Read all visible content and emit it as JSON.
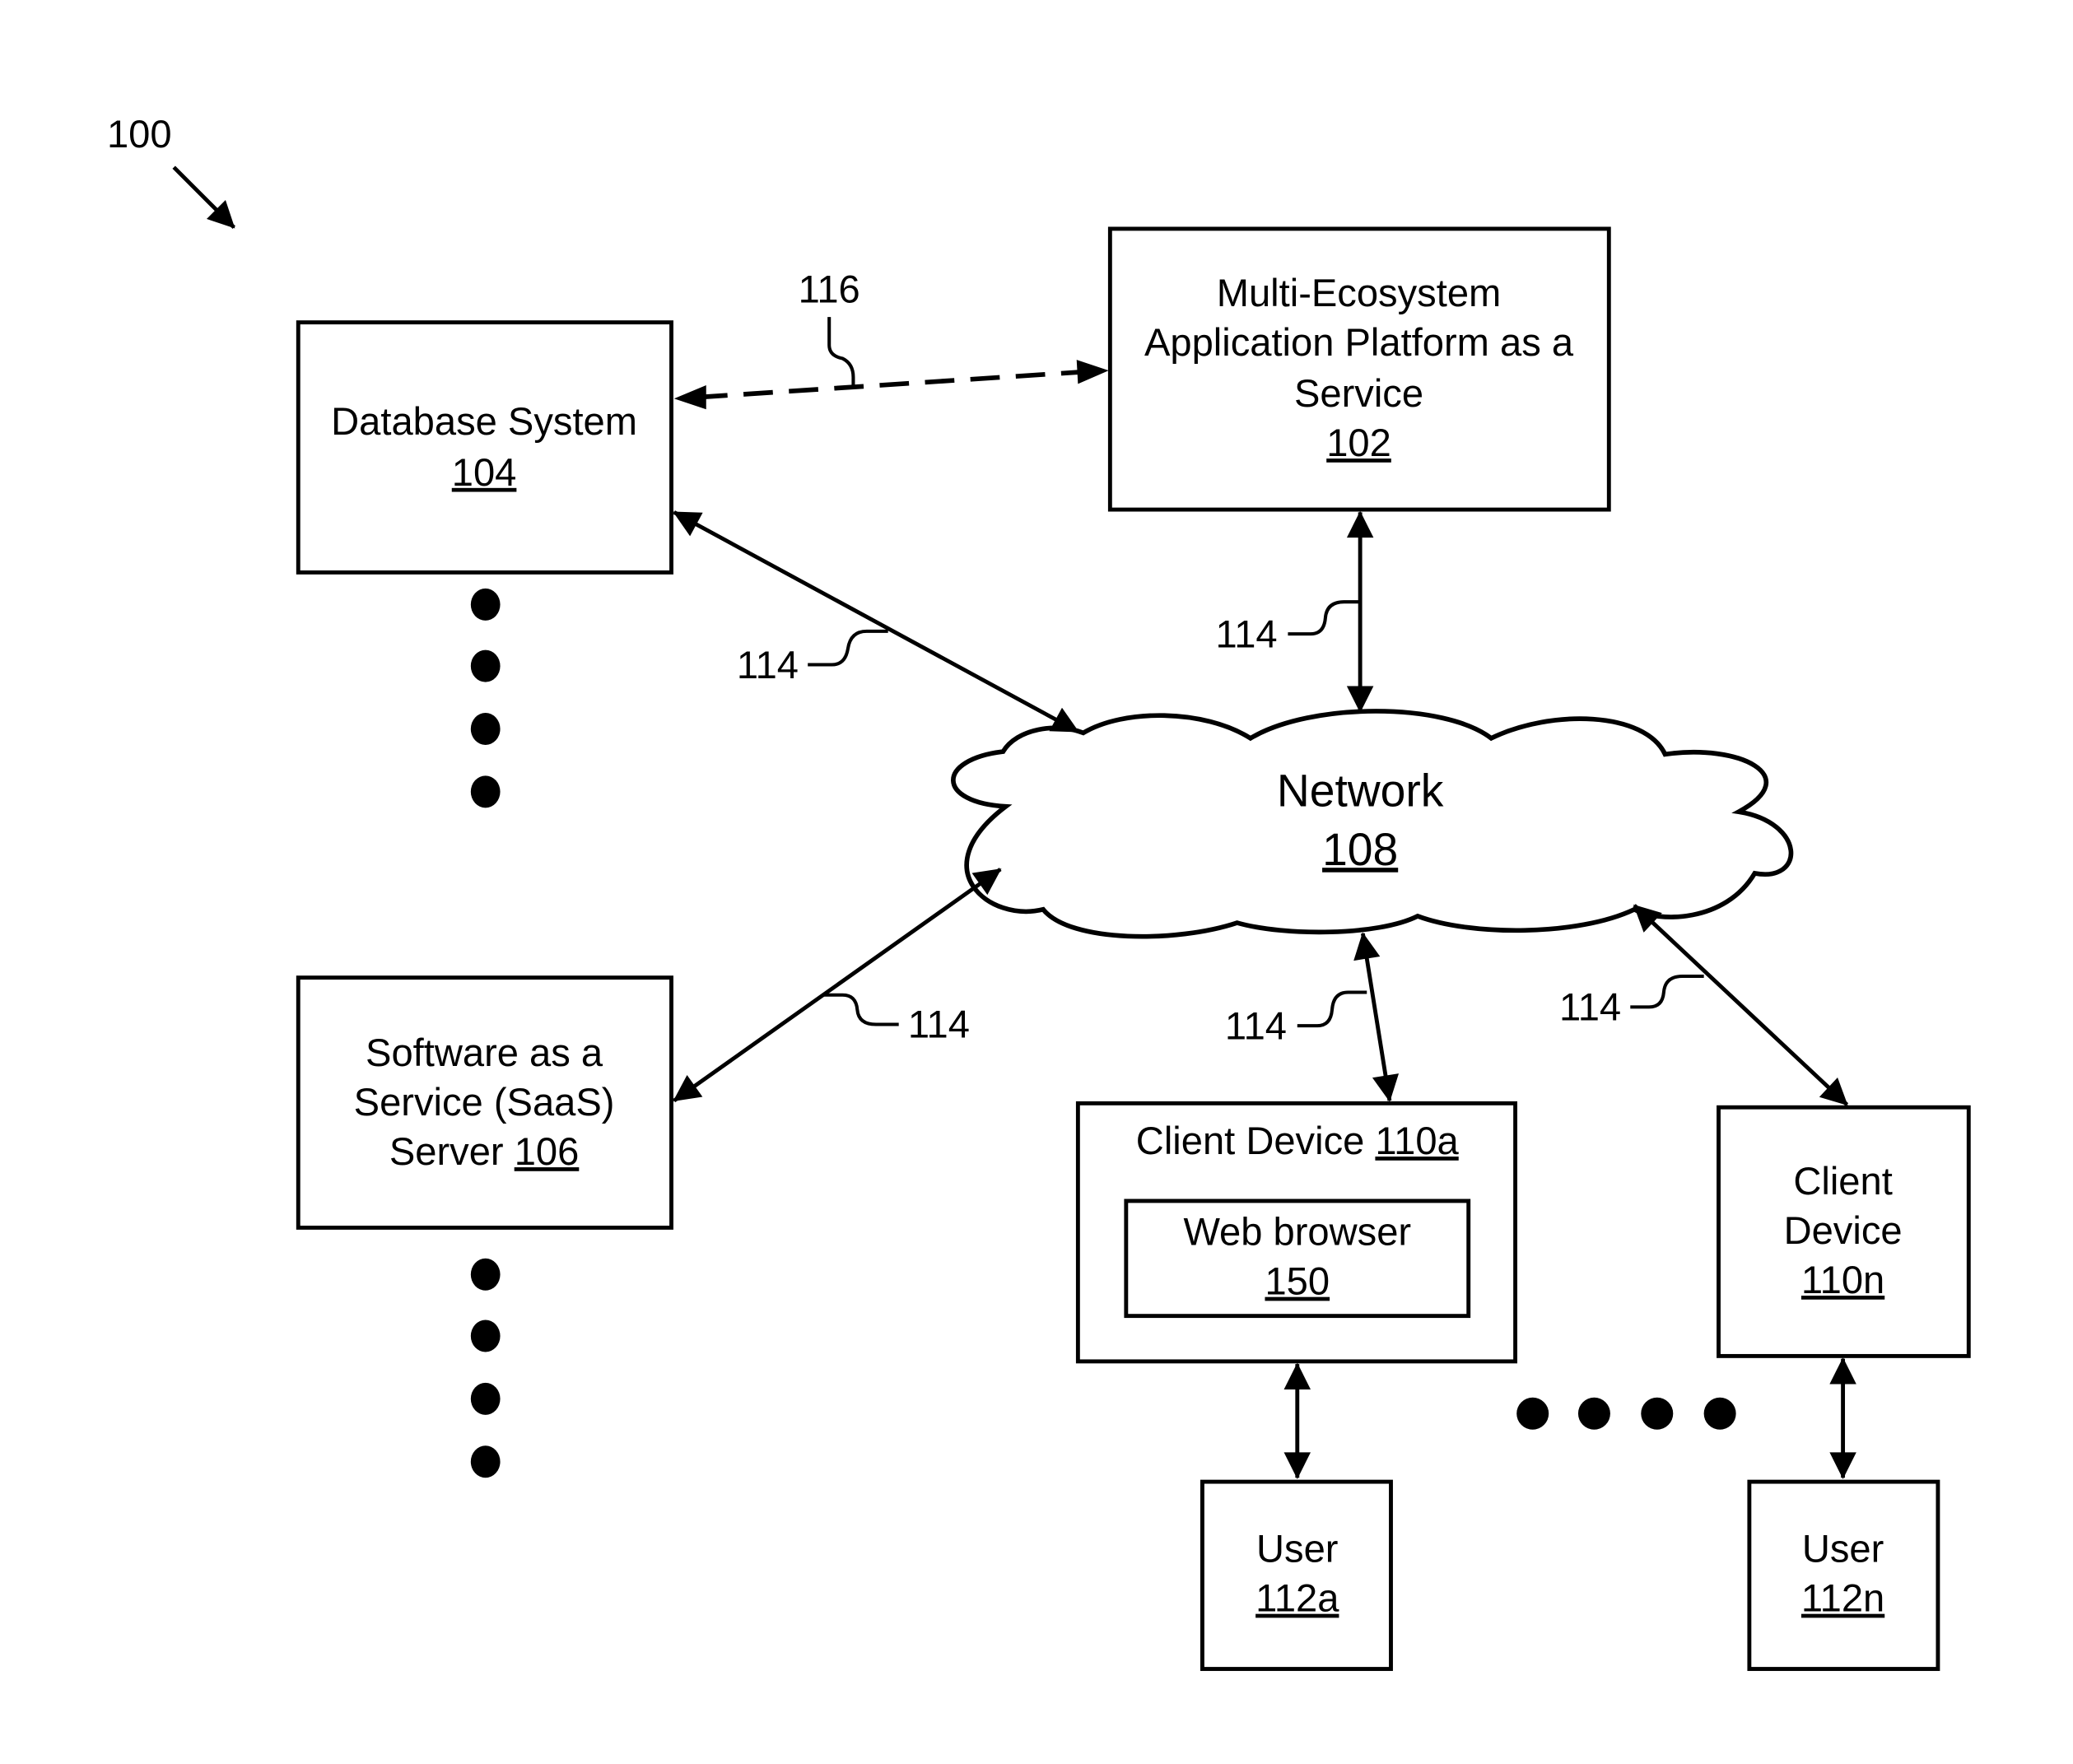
{
  "figure": {
    "ref": "100",
    "nodes": {
      "platform": {
        "lines": [
          "Multi-Ecosystem",
          "Application Platform as a",
          "Service"
        ],
        "ref": "102"
      },
      "database": {
        "lines": [
          "Database System"
        ],
        "ref": "104"
      },
      "saas": {
        "lines": [
          "Software as a",
          "Service (SaaS)"
        ],
        "prefix": "Server ",
        "ref": "106"
      },
      "network": {
        "lines": [
          "Network"
        ],
        "ref": "108"
      },
      "client_a": {
        "prefix": "Client Device ",
        "ref": "110a"
      },
      "browser": {
        "lines": [
          "Web browser"
        ],
        "ref": "150"
      },
      "client_n": {
        "lines": [
          "Client",
          "Device"
        ],
        "ref": "110n"
      },
      "user_a": {
        "lines": [
          "User"
        ],
        "ref": "112a"
      },
      "user_n": {
        "lines": [
          "User"
        ],
        "ref": "112n"
      }
    },
    "connection_labels": {
      "dashed": "116",
      "db_network": "114",
      "platform_network": "114",
      "saas_network": "114",
      "client_a_network": "114",
      "client_n_network": "114"
    },
    "colors": {
      "ink": "#000000",
      "background": "#ffffff"
    }
  }
}
